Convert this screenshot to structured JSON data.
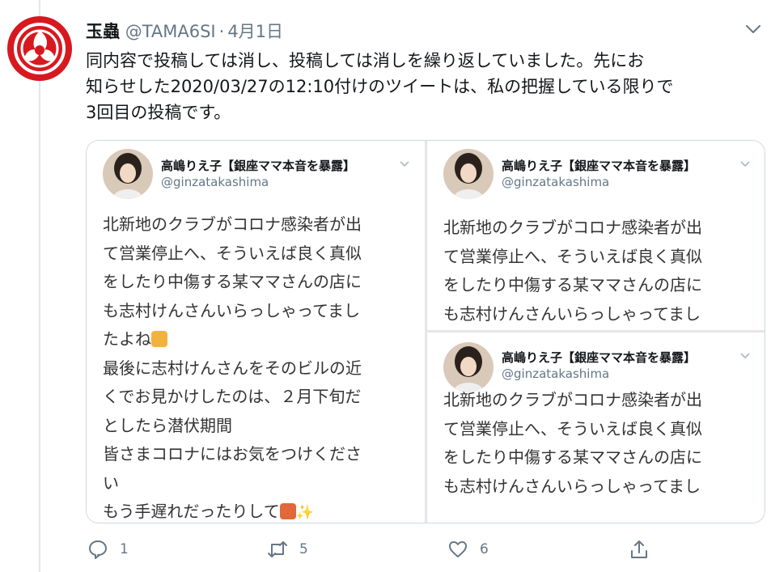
{
  "tweet": {
    "author_name": "玉蟲",
    "author_handle": "@TAMA6SI",
    "separator": "·",
    "date": "4月1日",
    "text_lines": [
      "同内容で投稿しては消し、投稿しては消しを繰り返していました。先にお",
      "知らせした2020/03/27の12:10付けのツイートは、私の把握している限りで",
      "3回目の投稿です。"
    ]
  },
  "media": {
    "left_panel": {
      "name": "高嶋りえ子【銀座ママ本音を暴露】",
      "handle": "@ginzatakashima",
      "lines": [
        "北新地のクラブがコロナ感染者が出",
        "て営業停止へ、そういえば良く真似",
        "をしたり中傷する某ママさんの店に",
        "も志村けんさんいらっしゃってまし",
        "たよね",
        "最後に志村けんさんをそのビルの近",
        "くでお見かけしたのは、２月下旬だ",
        "としたら潜伏期間",
        "皆さまコロナにはお気をつけくださ",
        "い",
        "もう手遅れだったりして"
      ]
    },
    "right_top_panel": {
      "name": "高嶋りえ子【銀座ママ本音を暴露】",
      "handle": "@ginzatakashima",
      "lines": [
        "北新地のクラブがコロナ感染者が出",
        "て営業停止へ、そういえば良く真似",
        "をしたり中傷する某ママさんの店に",
        "も志村けんさんいらっしゃってまし"
      ]
    },
    "right_bottom_panel": {
      "name": "高嶋りえ子【銀座ママ本音を暴露】",
      "handle": "@ginzatakashima",
      "lines": [
        "北新地のクラブがコロナ感染者が出",
        "て営業停止へ、そういえば良く真似",
        "をしたり中傷する某ママさんの店に",
        "も志村けんさんいらっしゃってまし"
      ]
    }
  },
  "actions": {
    "reply_count": "1",
    "retweet_count": "5",
    "like_count": "6"
  },
  "icons": {
    "avatar": "red-mitsudomoe-crest-icon",
    "more": "chevron-down-icon",
    "reply": "reply-icon",
    "retweet": "retweet-icon",
    "like": "heart-icon",
    "share": "share-icon"
  },
  "colors": {
    "accent_red": "#d7191f",
    "secondary_text": "#657786",
    "border": "#cfd9de"
  }
}
